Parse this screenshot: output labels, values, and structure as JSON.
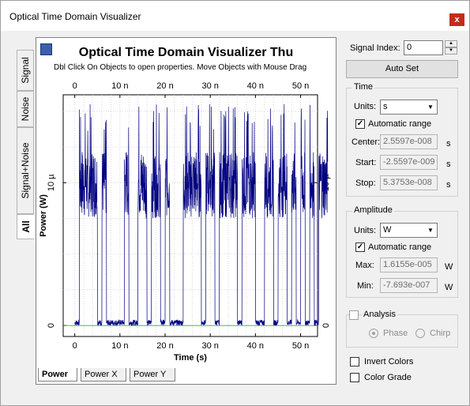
{
  "window": {
    "title": "Optical Time Domain Visualizer",
    "close_glyph": "x"
  },
  "side_tabs": [
    "Signal",
    "Noise",
    "Signal+Noise",
    "All"
  ],
  "plot": {
    "title": "Optical Time Domain Visualizer Thu",
    "subtitle": "Dbl Click On Objects to open properties.  Move Objects with Mouse Drag",
    "tabs": [
      "Power",
      "Power X",
      "Power Y"
    ]
  },
  "chart_data": {
    "type": "line",
    "xlabel": "Time (s)",
    "ylabel": "Power (W)",
    "x_ticks": [
      "0",
      "10 n",
      "20 n",
      "30 n",
      "40 n",
      "50 n"
    ],
    "y_ticks": [
      "0",
      "10 µ"
    ],
    "xlim": [
      -2.5597e-09,
      5.3753e-08
    ],
    "ylim": [
      -7.693e-07,
      1.6155e-05
    ],
    "grid": true,
    "series": [
      {
        "color": "#000080",
        "bit_period_ns": 1.0,
        "bits": [
          0,
          1,
          1,
          1,
          1,
          0,
          1,
          0,
          0,
          0,
          0,
          1,
          0,
          0,
          1,
          1,
          0,
          1,
          1,
          0,
          1,
          0,
          0,
          0,
          1,
          1,
          1,
          1,
          0,
          1,
          1,
          0,
          1,
          1,
          1,
          1,
          0,
          1,
          1,
          1,
          0,
          0,
          1,
          1,
          0,
          1,
          1,
          0,
          1,
          0,
          1,
          0,
          1,
          0,
          1,
          1
        ],
        "level_on_W": 1e-05,
        "level_off_W": 0,
        "peak_W": 1.55e-05
      }
    ]
  },
  "panel": {
    "signal_index_label": "Signal Index:",
    "signal_index_value": "0",
    "auto_set_label": "Auto Set",
    "time": {
      "group_label": "Time",
      "units_label": "Units:",
      "units_value": "s",
      "auto_range_label": "Automatic range",
      "auto_range_checked": true,
      "center_label": "Center:",
      "center_value": "2.5597e-008",
      "center_unit": "s",
      "start_label": "Start:",
      "start_value": "-2.5597e-009",
      "start_unit": "s",
      "stop_label": "Stop:",
      "stop_value": "5.3753e-008",
      "stop_unit": "s"
    },
    "amplitude": {
      "group_label": "Amplitude",
      "units_label": "Units:",
      "units_value": "W",
      "auto_range_label": "Automatic range",
      "auto_range_checked": true,
      "max_label": "Max:",
      "max_value": "1.6155e-005",
      "max_unit": "W",
      "min_label": "Min:",
      "min_value": "-7.693e-007",
      "min_unit": "W"
    },
    "analysis": {
      "label": "Analysis",
      "checked": false,
      "phase_label": "Phase",
      "chirp_label": "Chirp",
      "selected": "Phase"
    },
    "invert_colors_label": "Invert Colors",
    "color_grade_label": "Color Grade"
  }
}
